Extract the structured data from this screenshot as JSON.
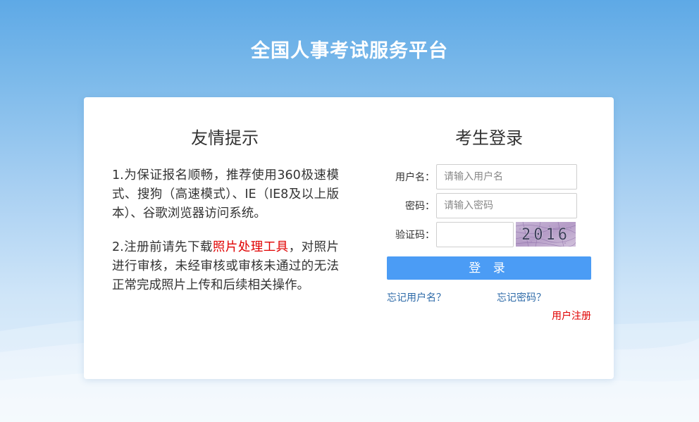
{
  "header": {
    "site_title": "全国人事考试服务平台"
  },
  "notice": {
    "title": "友情提示",
    "paragraph_1": "1.为保证报名顺畅，推荐使用360极速模式、搜狗（高速模式）、IE（IE8及以上版本）、谷歌浏览器访问系统。",
    "paragraph_2_before": "2.注册前请先下载",
    "paragraph_2_link": "照片处理工具",
    "paragraph_2_after": "，对照片进行审核，未经审核或审核未通过的无法正常完成照片上传和后续相关操作。"
  },
  "login": {
    "title": "考生登录",
    "username_label": "用户名：",
    "username_placeholder": "请输入用户名",
    "username_value": "",
    "password_label": "密码：",
    "password_placeholder": "请输入密码",
    "password_value": "",
    "captcha_label": "验证码：",
    "captcha_value": "",
    "captcha_code": "2016",
    "submit_label": "登 录",
    "forgot_username": "忘记用户名？",
    "forgot_password": "忘记密码？",
    "register": "用户注册"
  },
  "colors": {
    "accent": "#4b9cf5",
    "link": "#2d6aa8",
    "highlight": "#e00000",
    "background_top": "#5ea9e6"
  }
}
